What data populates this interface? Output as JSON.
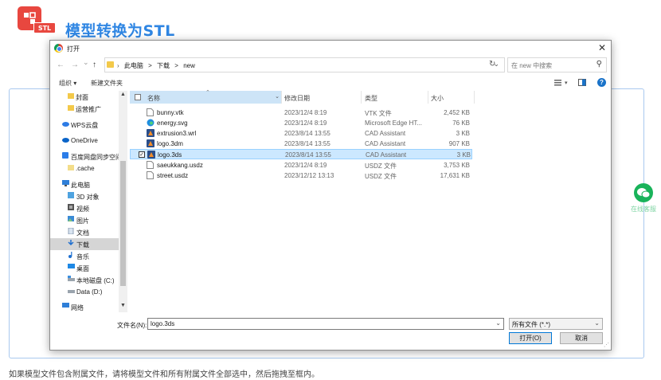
{
  "page": {
    "logo_tag": "STL",
    "title": "模型转换为STL",
    "hint": "如果模型文件包含附属文件，请将模型文件和所有附属文件全部选中，然后拖拽至框内。",
    "wechat_label": "在线客服"
  },
  "dialog": {
    "title": "打开",
    "nav": {
      "back": "←",
      "forward": "→",
      "recent": "⌄",
      "up": "↑"
    },
    "breadcrumbs": [
      "此电脑",
      ">",
      "下载",
      ">",
      "new"
    ],
    "search_placeholder": "在 new 中搜索",
    "toolbar": {
      "organize": "组织 ▾",
      "new_folder": "新建文件夹"
    },
    "sidebar": [
      {
        "label": "封面",
        "icon": "folder-icon"
      },
      {
        "label": "运营推广",
        "icon": "folder-icon"
      },
      {
        "label": "WPS云盘",
        "icon": "cloud-icon"
      },
      {
        "label": "OneDrive",
        "icon": "onedrive-icon"
      },
      {
        "label": "百度网盘同步空间",
        "icon": "baidu-icon"
      },
      {
        "label": ".cache",
        "icon": "folder-icon"
      },
      {
        "label": "此电脑",
        "icon": "computer-icon"
      },
      {
        "label": "3D 对象",
        "icon": "3d-objects-icon"
      },
      {
        "label": "视频",
        "icon": "video-icon"
      },
      {
        "label": "图片",
        "icon": "picture-icon"
      },
      {
        "label": "文档",
        "icon": "document-icon"
      },
      {
        "label": "下载",
        "icon": "download-icon"
      },
      {
        "label": "音乐",
        "icon": "music-icon"
      },
      {
        "label": "桌面",
        "icon": "desktop-icon"
      },
      {
        "label": "本地磁盘 (C:)",
        "icon": "drive-icon"
      },
      {
        "label": "Data (D:)",
        "icon": "drive-icon"
      },
      {
        "label": "网络",
        "icon": "network-icon"
      }
    ],
    "columns": {
      "name": "名称",
      "date": "修改日期",
      "type": "类型",
      "size": "大小"
    },
    "files": [
      {
        "name": "bunny.vtk",
        "date": "2023/12/4 8:19",
        "type": "VTK 文件",
        "size": "2,452 KB",
        "icon": "file-icon"
      },
      {
        "name": "energy.svg",
        "date": "2023/12/4 8:19",
        "type": "Microsoft Edge HT...",
        "size": "76 KB",
        "icon": "edge-icon"
      },
      {
        "name": "extrusion3.wrl",
        "date": "2023/8/14 13:55",
        "type": "CAD Assistant",
        "size": "3 KB",
        "icon": "cad-icon"
      },
      {
        "name": "logo.3dm",
        "date": "2023/8/14 13:55",
        "type": "CAD Assistant",
        "size": "907 KB",
        "icon": "cad-icon"
      },
      {
        "name": "logo.3ds",
        "date": "2023/8/14 13:55",
        "type": "CAD Assistant",
        "size": "3 KB",
        "icon": "cad-icon"
      },
      {
        "name": "saeukkang.usdz",
        "date": "2023/12/4 8:19",
        "type": "USDZ 文件",
        "size": "3,753 KB",
        "icon": "file-icon"
      },
      {
        "name": "street.usdz",
        "date": "2023/12/12 13:13",
        "type": "USDZ 文件",
        "size": "17,631 KB",
        "icon": "file-icon"
      }
    ],
    "selected_file": "logo.3ds",
    "filename_label": "文件名(N):",
    "filename_value": "logo.3ds",
    "filetype_value": "所有文件 (*.*)",
    "open_button": "打开(O)",
    "cancel_button": "取消"
  },
  "colors": {
    "brand_red": "#e8473f",
    "title_blue": "#2f86e3",
    "selection_blue": "#cce8ff",
    "wechat_green": "#19b35a"
  }
}
